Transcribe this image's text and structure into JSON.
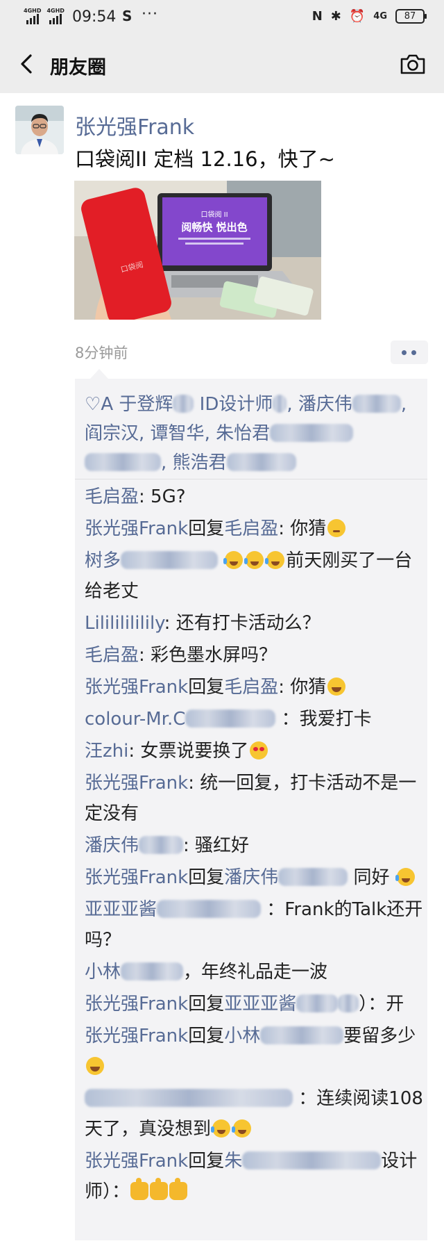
{
  "status_bar": {
    "signal1_label": "4GHD",
    "signal2_label": "4GHD",
    "time": "09:54",
    "app_symbol": "S",
    "more_dots": "···",
    "nfc": "N",
    "bluetooth": "✱",
    "alarm": "⏰",
    "network": "4G",
    "battery": "87"
  },
  "nav": {
    "title": "朋友圈"
  },
  "post": {
    "author": "张光强Frank",
    "text": "口袋阅II 定档 12.16，快了~",
    "image": {
      "screen_title": "口袋阅 II",
      "screen_slogan": "阅畅快 悦出色",
      "device_logo": "口袋阅"
    },
    "time_ago": "8分钟前"
  },
  "likes": {
    "prefix": "A",
    "names": [
      {
        "text": "于登辉"
      },
      {
        "text": "ID设计师"
      },
      {
        "text": "潘庆伟"
      },
      {
        "text": "阎宗汉"
      },
      {
        "text": "谭智华"
      },
      {
        "text": "朱怡君"
      },
      {
        "text": "熊浩君"
      }
    ]
  },
  "comments": [
    {
      "name": "毛启盈",
      "sep": ": ",
      "text": "5G?"
    },
    {
      "name": "张光强Frank",
      "reply": "回复",
      "to": "毛启盈",
      "sep": ": ",
      "text": "你猜"
    },
    {
      "name": "树多",
      "sep": "",
      "text": "前天刚买了一台给老丈"
    },
    {
      "name": "Lilililililily",
      "sep": ": ",
      "text": "还有打卡活动么？"
    },
    {
      "name": "毛启盈",
      "sep": ": ",
      "text": "彩色墨水屏吗？"
    },
    {
      "name": "张光强Frank",
      "reply": "回复",
      "to": "毛启盈",
      "sep": ": ",
      "text": "你猜"
    },
    {
      "name": "colour-Mr.C",
      "sep": "：",
      "text": "我爱打卡"
    },
    {
      "name": "汪zhi",
      "sep": ": ",
      "text": "女票说要换了"
    },
    {
      "name": "张光强Frank",
      "sep": ": ",
      "text": "统一回复，打卡活动不是一定没有"
    },
    {
      "name": "潘庆伟",
      "sep": ": ",
      "text": "骚红好"
    },
    {
      "name": "张光强Frank",
      "reply": "回复",
      "to": "潘庆伟",
      "sep": "",
      "text": "同好"
    },
    {
      "name": "亚亚亚酱",
      "sep": "：",
      "text": "Frank的Talk还开吗？"
    },
    {
      "name": "小林",
      "sep": "，",
      "text": "年终礼品走一波"
    },
    {
      "name": "张光强Frank",
      "reply": "回复",
      "to": "亚亚亚酱",
      "sep": "）：",
      "text": "开"
    },
    {
      "name": "张光强Frank",
      "reply": "回复",
      "to": "小林",
      "sep": "",
      "text": "要留多少"
    },
    {
      "name": "",
      "sep": "：",
      "text": "连续阅读108天了，真没想到"
    },
    {
      "name": "张光强Frank",
      "reply": "回复",
      "to": "朱",
      "sep": "设计师）：",
      "text": ""
    }
  ],
  "colors": {
    "link": "#576b95",
    "bar_bg": "#ededed",
    "comment_bg": "#f3f3f5"
  }
}
